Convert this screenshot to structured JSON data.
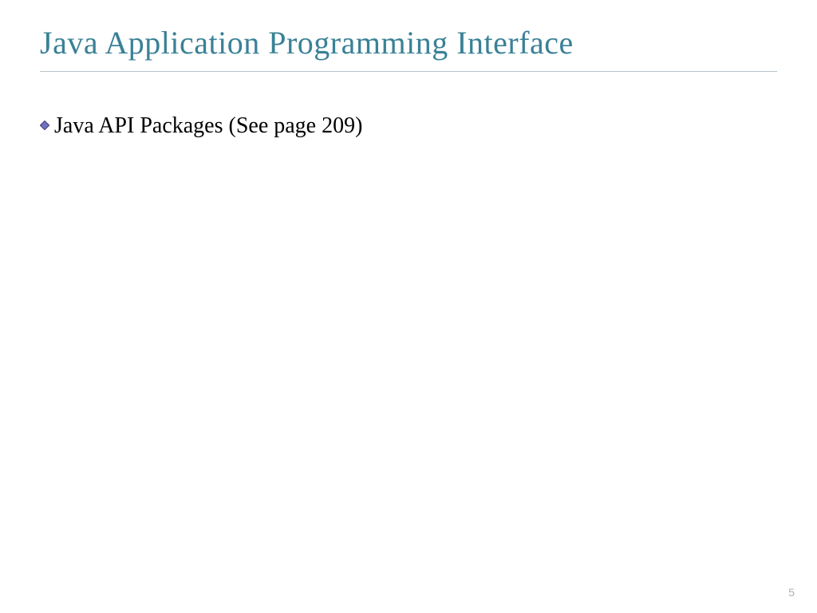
{
  "slide": {
    "title": "Java Application Programming Interface",
    "bullets": [
      {
        "text": "Java API Packages (See page 209)"
      }
    ],
    "page_number": "5"
  },
  "colors": {
    "title": "#3a8196",
    "underline": "#b5c4ca",
    "bullet_fill": "#5a5ab0",
    "bullet_stroke": "#2a2a60",
    "text": "#000000",
    "page_number": "#b0b0b0"
  }
}
